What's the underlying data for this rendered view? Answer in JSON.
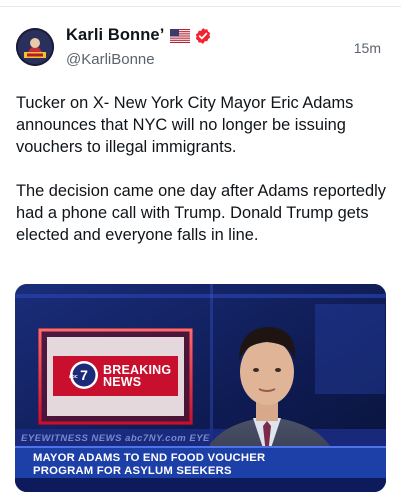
{
  "post": {
    "author": {
      "display_name": "Karli Bonne’",
      "handle": "@KarliBonne",
      "avatar_icon": "avatar-image",
      "flag_icon": "us-flag-icon",
      "verified_icon": "verified-badge-icon",
      "verified_color": "#f4212e"
    },
    "timestamp": "15m",
    "paragraphs": [
      "Tucker on X- New York City Mayor Eric Adams announces that NYC will no longer be issuing vouchers to illegal immigrants.",
      "The decision came one day after Adams reportedly had a phone call with Trump. Donald Trump gets elected and everyone falls in line."
    ],
    "media": {
      "breaking_line1": "BREAKING",
      "breaking_line2": "NEWS",
      "abc_logo": "abc7",
      "ticker_text": "EYEWITNESS NEWS  abc7NY.com  EYE",
      "lower_third_line1": "MAYOR ADAMS TO END FOOD VOUCHER",
      "lower_third_line2": "PROGRAM FOR ASYLUM SEEKERS",
      "breaking_color": "#c8102e",
      "lower_third_color": "#1d3fa8"
    }
  }
}
